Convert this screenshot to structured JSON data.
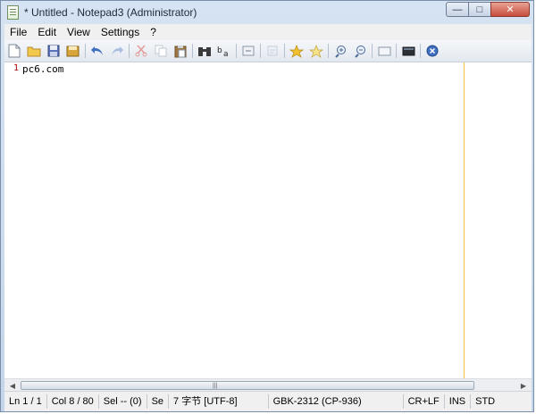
{
  "window": {
    "title": "* Untitled - Notepad3 (Administrator)"
  },
  "caption_buttons": {
    "minimize": "—",
    "maximize": "□",
    "close": "✕"
  },
  "menu": [
    "File",
    "Edit",
    "View",
    "Settings",
    "?"
  ],
  "toolbar": {
    "icons": [
      "new-file-icon",
      "open-folder-icon",
      "save-icon",
      "save-as-icon",
      "undo-icon",
      "redo-icon",
      "cut-icon",
      "copy-icon",
      "paste-icon",
      "find-icon",
      "replace-icon",
      "goto-icon",
      "wordwrap-icon",
      "favorite-add-icon",
      "favorites-icon",
      "zoom-in-icon",
      "zoom-out-icon",
      "view-icon",
      "console-icon",
      "close-icon"
    ]
  },
  "editor": {
    "lines": [
      {
        "number": "1",
        "text": "pc6.com"
      }
    ]
  },
  "scrollbar": {
    "grip": "|||"
  },
  "status": {
    "ln": "Ln 1 / 1",
    "col": "Col 8 / 80",
    "sel": "Sel -- (0)",
    "se": "Se",
    "bytes": "7 字节 [UTF-8]",
    "encoding": "GBK-2312 (CP-936)",
    "eol": "CR+LF",
    "ins": "INS",
    "scheme": "STD"
  }
}
